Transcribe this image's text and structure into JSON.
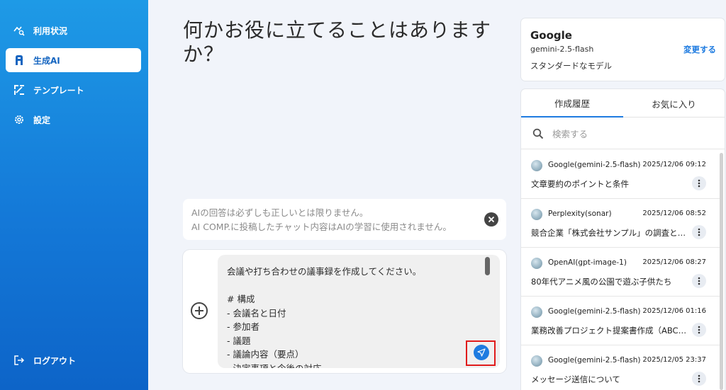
{
  "sidebar": {
    "items": [
      {
        "label": "利用状況",
        "icon": "usage-chart-icon"
      },
      {
        "label": "生成AI",
        "icon": "ai-logo-icon"
      },
      {
        "label": "テンプレート",
        "icon": "template-grid-icon"
      },
      {
        "label": "設定",
        "icon": "gear-icon"
      }
    ],
    "logout_label": "ログアウト"
  },
  "main": {
    "heading": "何かお役に立てることはありますか？",
    "notice": {
      "line1": "AIの回答は必ずしも正しいとは限りません。",
      "line2": "AI COMP.に投稿したチャット内容はAIの学習に使用されません。"
    },
    "composer": {
      "prompt_text": "会議や打ち合わせの議事録を作成してください。\n\n# 構成\n- 会議名と日付\n- 参加者\n- 議題\n- 議論内容（要点）\n- 決定事項と今後の対応"
    }
  },
  "model": {
    "provider": "Google",
    "name": "gemini-2.5-flash",
    "description": "スタンダードなモデル",
    "change_label": "変更する"
  },
  "history": {
    "tabs": [
      {
        "label": "作成履歴",
        "active": true
      },
      {
        "label": "お気に入り",
        "active": false
      }
    ],
    "search_placeholder": "検索する",
    "items": [
      {
        "model": "Google(gemini-2.5-flash)",
        "date": "2025/12/06 09:12",
        "title": "文章要約のポイントと条件"
      },
      {
        "model": "Perplexity(sonar)",
        "date": "2025/12/06 08:52",
        "title": "競合企業「株式会社サンプル」の調査と…"
      },
      {
        "model": "OpenAI(gpt-image-1)",
        "date": "2025/12/06 08:27",
        "title": "80年代アニメ風の公園で遊ぶ子供たち"
      },
      {
        "model": "Google(gemini-2.5-flash)",
        "date": "2025/12/06 01:16",
        "title": "業務改善プロジェクト提案書作成（ABC…"
      },
      {
        "model": "Google(gemini-2.5-flash)",
        "date": "2025/12/05 23:37",
        "title": "メッセージ送信について"
      }
    ]
  },
  "colors": {
    "sidebar_top": "#1e9ae6",
    "sidebar_bottom": "#0d64c8",
    "accent": "#1e7be0",
    "highlight_frame": "#e01b1b"
  }
}
